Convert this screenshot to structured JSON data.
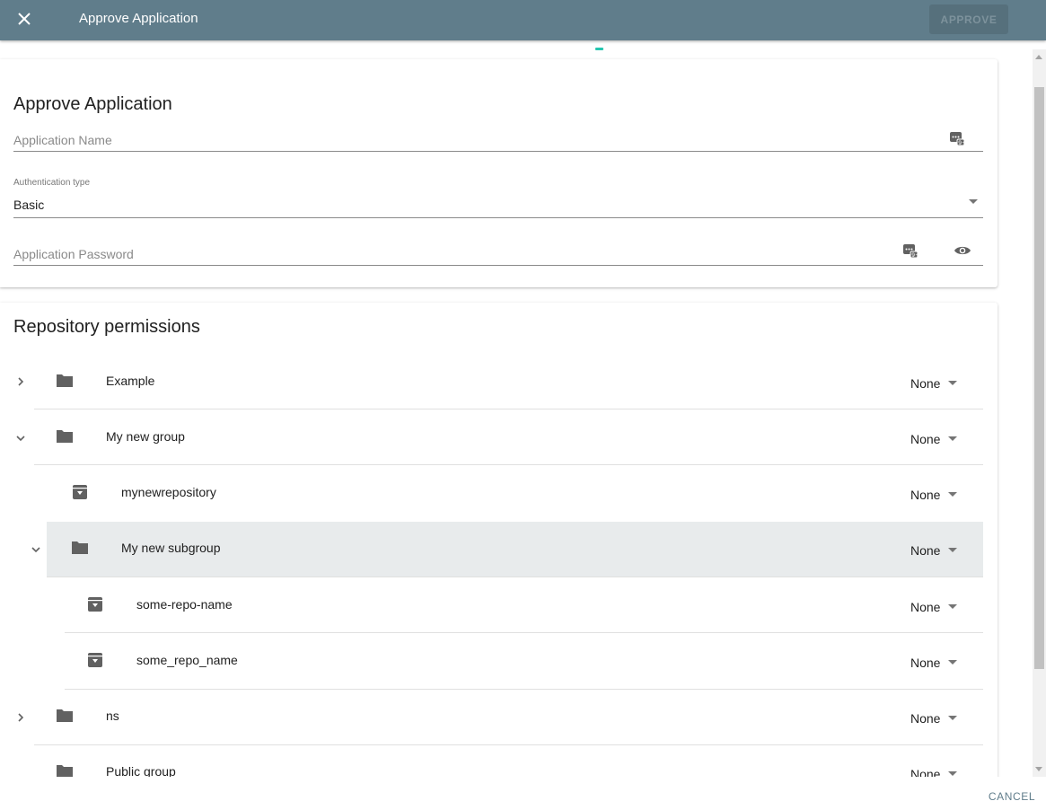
{
  "topbar": {
    "close_icon": "close-icon",
    "title": "Approve Application",
    "approve_label": "APPROVE"
  },
  "form": {
    "title": "Approve Application",
    "name_placeholder": "Application Name",
    "auth_label": "Authentication type",
    "auth_value": "Basic",
    "password_placeholder": "Application Password",
    "generate_icon": "password-generator-icon",
    "visibility_icon": "eye-icon"
  },
  "permissions": {
    "title": "Repository permissions",
    "rows": [
      {
        "label": "Example",
        "type": "group",
        "chevron": "collapsed",
        "value": "None"
      },
      {
        "label": "My new group",
        "type": "group",
        "chevron": "expanded",
        "value": "None"
      },
      {
        "label": "mynewrepository",
        "type": "repo",
        "chevron": "none",
        "value": "None"
      },
      {
        "label": "My new subgroup",
        "type": "group",
        "chevron": "expanded",
        "value": "None",
        "selected": true
      },
      {
        "label": "some-repo-name",
        "type": "repo",
        "chevron": "none",
        "value": "None"
      },
      {
        "label": "some_repo_name",
        "type": "repo",
        "chevron": "none",
        "value": "None"
      },
      {
        "label": "ns",
        "type": "group",
        "chevron": "collapsed",
        "value": "None"
      },
      {
        "label": "Public group",
        "type": "group",
        "chevron": "collapsed",
        "value": "None"
      }
    ]
  },
  "footer": {
    "cancel_label": "CANCEL"
  },
  "colors": {
    "toolbar": "#607d8b",
    "accent": "#26c6b0",
    "selected_row": "#e8ebec"
  }
}
